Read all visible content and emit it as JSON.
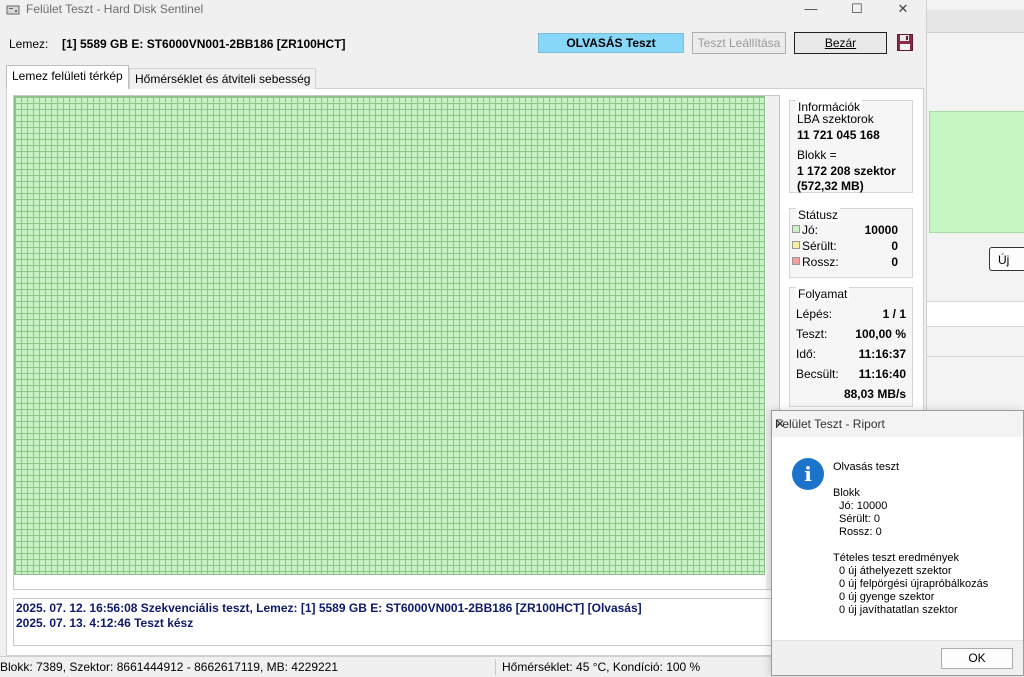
{
  "window": {
    "title": "Felület Teszt - Hard Disk Sentinel",
    "minimize": "—",
    "maximize": "☐",
    "close": "✕"
  },
  "toolbar": {
    "disk_label": "Lemez:",
    "disk_value": "[1] 5589 GB E: ST6000VN001-2BB186 [ZR100HCT]",
    "read_test_label": "OLVASÁS Teszt",
    "stop_label": "Teszt Leállítása",
    "close_label": "Bezár"
  },
  "tabs": [
    {
      "label": "Lemez felületi térkép",
      "active": true
    },
    {
      "label": "Hőmérséklet és átviteli sebesség",
      "active": false
    }
  ],
  "info": {
    "title": "Információk",
    "lba_label": "LBA szektorok",
    "lba_value": "11 721 045 168",
    "block_label": "Blokk =",
    "block_value": "1 172 208 szektor",
    "block_size": "(572,32 MB)"
  },
  "status": {
    "title": "Státusz",
    "good_label": "Jó:",
    "good_value": "10000",
    "damaged_label": "Sérült:",
    "damaged_value": "0",
    "bad_label": "Rossz:",
    "bad_value": "0",
    "colors": {
      "good": "#c9f1c6",
      "damaged": "#f5f0a0",
      "bad": "#f0a0a0"
    }
  },
  "progress": {
    "title": "Folyamat",
    "step_label": "Lépés:",
    "step_value": "1 / 1",
    "test_label": "Teszt:",
    "test_value": "100,00 %",
    "time_label": "Idő:",
    "time_value": "11:16:37",
    "est_label": "Becsült:",
    "est_value": "11:16:40",
    "speed": "88,03 MB/s"
  },
  "log": [
    "2025. 07. 12.  16:56:08   Szekvenciális teszt, Lemez: [1] 5589 GB E: ST6000VN001-2BB186 [ZR100HCT] [Olvasás]",
    "2025. 07. 13.  4:12:46   Teszt kész"
  ],
  "statusbar": {
    "left": "Blokk: 7389, Szektor: 8661444912 - 8662617119, MB: 4229221",
    "right": "Hőmérséklet: 45  °C,  Kondíció: 100 %"
  },
  "dialog": {
    "title": "Felület Teszt - Riport",
    "heading": "Olvasás teszt",
    "block_title": "Blokk",
    "good": "Jó: 10000",
    "damaged": "Sérült: 0",
    "bad": "Rossz: 0",
    "results_title": "Tételes teszt eredmények",
    "results": [
      "0 új áthelyezett szektor",
      "0 új felpörgési újrapróbálkozás",
      "0 új gyenge szektor",
      "0 új javíthatatlan szektor"
    ],
    "ok_label": "OK",
    "close": "✕"
  },
  "background_window": {
    "button_label": "Új"
  },
  "icons": {
    "app": "hard-disk-icon",
    "save": "floppy-disk-icon",
    "info": "information-icon"
  }
}
